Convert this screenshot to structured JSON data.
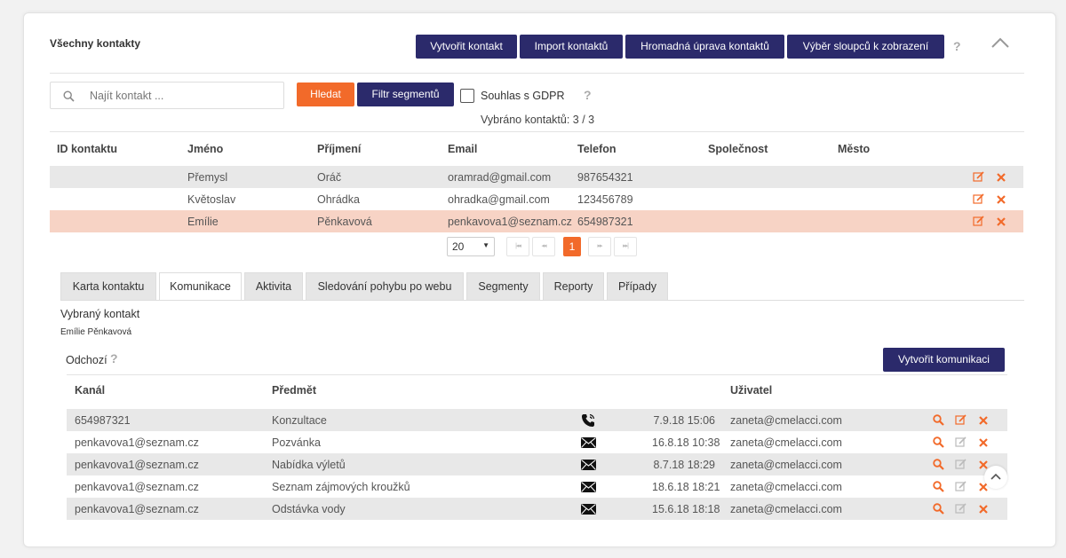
{
  "header": {
    "title": "Všechny kontakty",
    "buttons": [
      "Vytvořit kontakt",
      "Import kontaktů",
      "Hromadná úprava kontaktů",
      "Výběr sloupců k zobrazení"
    ],
    "help": "?",
    "collapse_icon": "chevron-up-icon"
  },
  "search": {
    "placeholder": "Najít kontakt ...",
    "search_button": "Hledat",
    "filter_button": "Filtr segmentů",
    "gdpr_label": "Souhlas s GDPR",
    "gdpr_checked": false,
    "help": "?",
    "selected_text": "Vybráno kontaktů: 3 / 3"
  },
  "contacts": {
    "columns": [
      "ID kontaktu",
      "Jméno",
      "Příjmení",
      "Email",
      "Telefon",
      "Společnost",
      "Město"
    ],
    "rows": [
      {
        "id": "",
        "first": "Přemysl",
        "last": "Oráč",
        "email": "oramrad@gmail.com",
        "phone": "987654321",
        "company": "",
        "city": ""
      },
      {
        "id": "",
        "first": "Květoslav",
        "last": "Ohrádka",
        "email": "ohradka@gmail.com",
        "phone": "123456789",
        "company": "",
        "city": ""
      },
      {
        "id": "",
        "first": "Emílie",
        "last": "Pěnkavová",
        "email": "penkavova1@seznam.cz",
        "phone": "654987321",
        "company": "",
        "city": "",
        "selected": true
      }
    ],
    "colors": {
      "odd_row": "#e8e8e8",
      "even_row": "#ffffff",
      "selected_row": "#f7d3c5",
      "action": "#f26a2a"
    }
  },
  "pagination": {
    "page_size": "20",
    "current_page": "1",
    "first": "|◂◂",
    "prev": "◂◂",
    "next": "▸▸",
    "last": "▸▸|"
  },
  "tabs": [
    "Karta kontaktu",
    "Komunikace",
    "Aktivita",
    "Sledování pohybu po webu",
    "Segmenty",
    "Reporty",
    "Případy"
  ],
  "active_tab": "Komunikace",
  "selected_contact": {
    "label": "Vybraný kontakt",
    "name": "Emílie Pěnkavová"
  },
  "communication": {
    "section_label": "Odchozí",
    "help": "?",
    "create_button": "Vytvořit komunikaci",
    "columns": [
      "Kanál",
      "Předmět",
      "",
      "",
      "Uživatel"
    ],
    "rows": [
      {
        "channel": "654987321",
        "subject": "Konzultace",
        "type_icon": "phone-icon",
        "date": "7.9.18 15:06",
        "user": "zaneta@cmelacci.com"
      },
      {
        "channel": "penkavova1@seznam.cz",
        "subject": "Pozvánka",
        "type_icon": "envelope-icon",
        "date": "16.8.18 10:38",
        "user": "zaneta@cmelacci.com"
      },
      {
        "channel": "penkavova1@seznam.cz",
        "subject": "Nabídka výletů",
        "type_icon": "envelope-icon",
        "date": "8.7.18 18:29",
        "user": "zaneta@cmelacci.com"
      },
      {
        "channel": "penkavova1@seznam.cz",
        "subject": "Seznam zájmových kroužků",
        "type_icon": "envelope-icon",
        "date": "18.6.18 18:21",
        "user": "zaneta@cmelacci.com"
      },
      {
        "channel": "penkavova1@seznam.cz",
        "subject": "Odstávka vody",
        "type_icon": "envelope-icon",
        "date": "15.6.18 18:18",
        "user": "zaneta@cmelacci.com"
      }
    ]
  },
  "colors": {
    "primary": "#2b2a6b",
    "accent": "#f26a2a"
  }
}
